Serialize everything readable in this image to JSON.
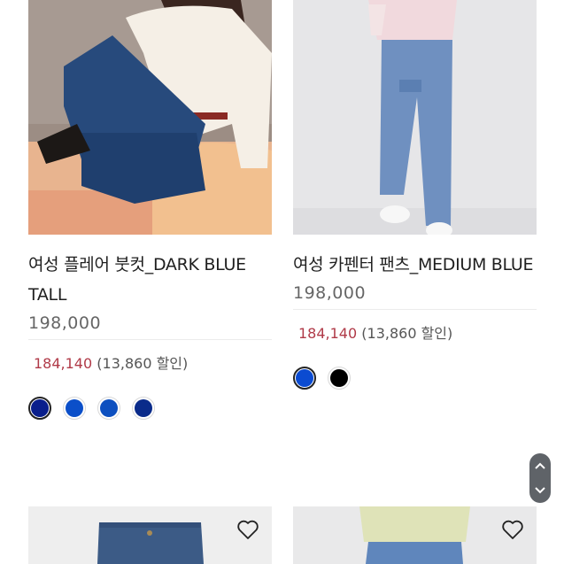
{
  "products": [
    {
      "name": "여성 플레어 붓컷_DARK BLUE TALL",
      "price": "198,000",
      "sale_price": "184,140",
      "discount": "(13,860 할인)",
      "colors": [
        "#0a1f8c",
        "#0b4fc9",
        "#0c4fbf",
        "#0a2b8a"
      ],
      "selected_color_index": 0
    },
    {
      "name": "여성 카펜터 팬츠_MEDIUM BLUE",
      "price": "198,000",
      "sale_price": "184,140",
      "discount": "(13,860 할인)",
      "colors": [
        "#0b4bd1",
        "#000000"
      ],
      "selected_color_index": 0
    }
  ],
  "bottom_products": [
    {
      "wishlist_icon": "heart-outline-icon"
    },
    {
      "wishlist_icon": "heart-outline-icon"
    }
  ],
  "scroll_control": {
    "up_icon": "chevron-up-icon",
    "down_icon": "chevron-down-icon"
  }
}
